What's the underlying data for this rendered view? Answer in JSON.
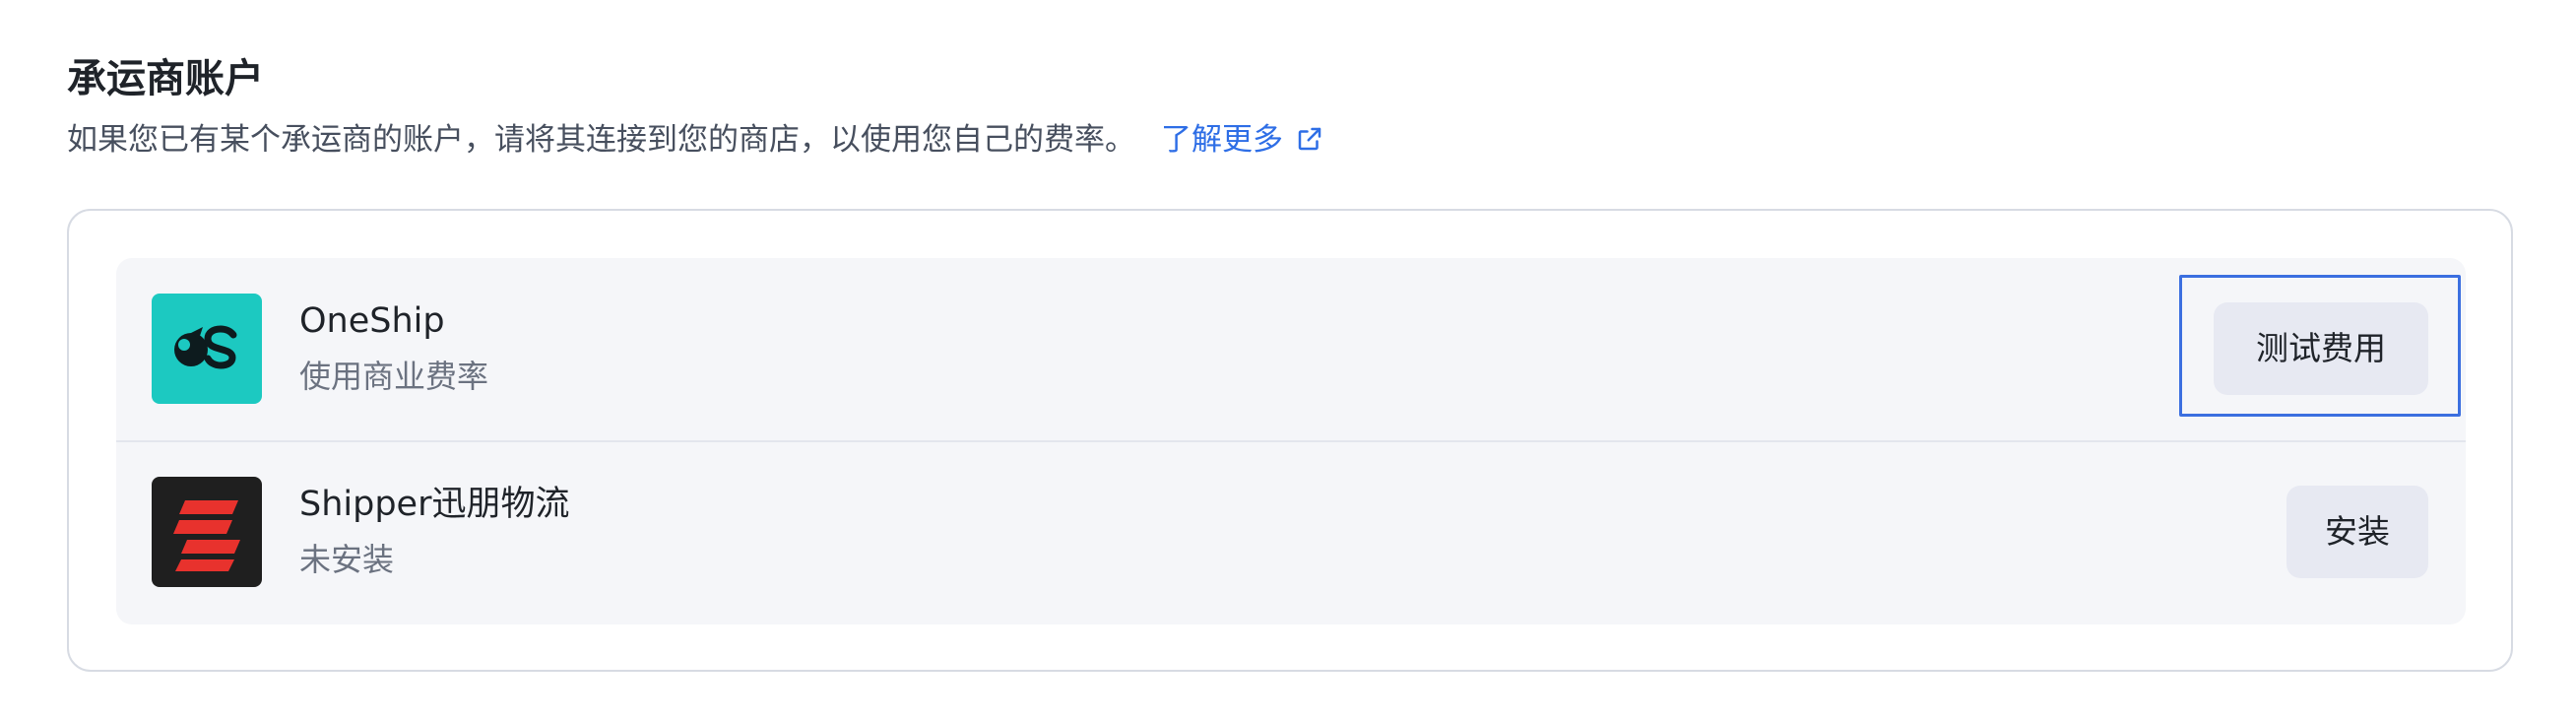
{
  "header": {
    "title": "承运商账户",
    "description": "如果您已有某个承运商的账户，请将其连接到您的商店，以使用您自己的费率。",
    "learn_more": "了解更多"
  },
  "carriers": [
    {
      "name": "OneShip",
      "subtitle": "使用商业费率",
      "action_label": "测试费用",
      "logo_icon": "oneship-logo-icon",
      "logo_color": "#1cc9c1"
    },
    {
      "name": "Shipper迅朋物流",
      "subtitle": "未安装",
      "action_label": "安装",
      "logo_icon": "shipper-logo-icon",
      "logo_color": "#1f1f1f"
    }
  ],
  "colors": {
    "link": "#2e6ee6",
    "focus_ring": "#3b6fe0",
    "button_bg": "#e7e9f2",
    "list_bg": "#f5f6f9"
  },
  "icons": {
    "external_link": "external-link-icon"
  }
}
